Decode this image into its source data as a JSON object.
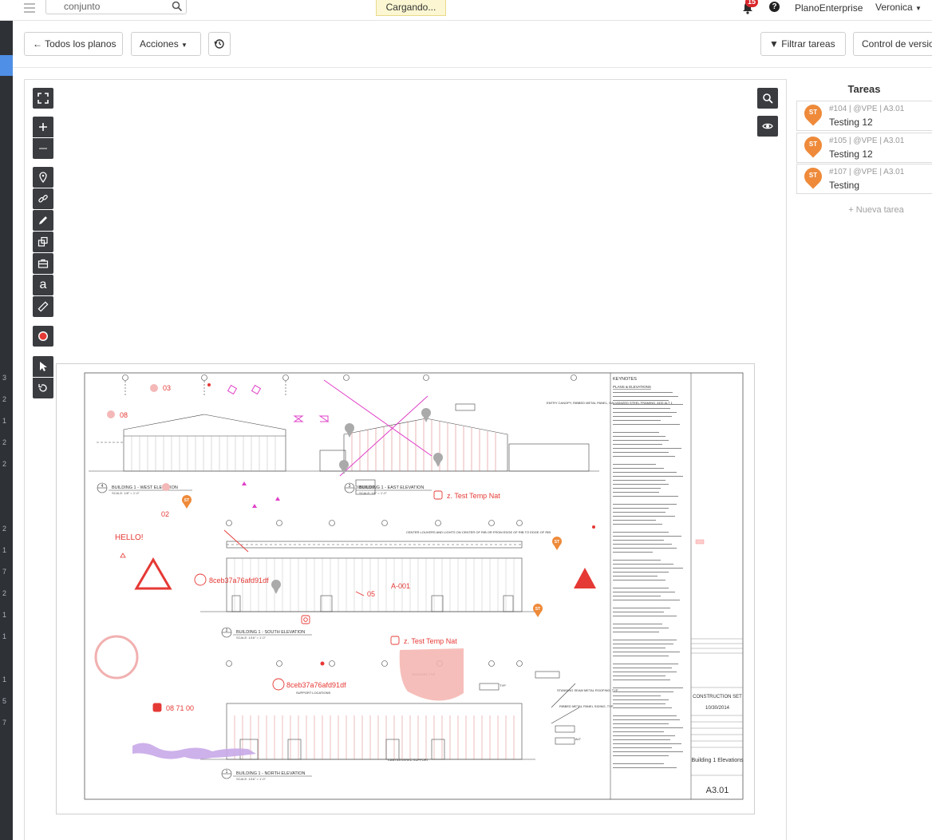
{
  "topbar": {
    "search_value": "conjunto",
    "loading_text": "Cargando...",
    "notifications_count": "15",
    "help": "?",
    "company": "PlanoEnterprise",
    "user": "Veronica"
  },
  "toolbar": {
    "all_plans": "Todos los planos",
    "actions": "Acciones",
    "filter_tasks": "Filtrar tareas",
    "version_control": "Control de versio"
  },
  "left_strip_numbers": [
    "3",
    "2",
    "1",
    "2",
    "2",
    "2",
    "1",
    "7",
    "2",
    "1",
    "1",
    "1",
    "5",
    "7"
  ],
  "sheet": {
    "annotations": {
      "n03": "03",
      "n08": "08",
      "n02": "02",
      "hello": "HELLO!",
      "link1": "8ceb37a76afd91df",
      "link2": "8ceb37a76afd91df",
      "a001": "A-001",
      "n05": "05",
      "temp1": "z. Test Temp Nat",
      "temp2": "z. Test Temp Nat",
      "num_087100": "08 71 00",
      "st": "ST"
    },
    "labels": {
      "west_num": "4",
      "west": "BUILDING 1 - WEST ELEVATION",
      "east_num": "3",
      "east": "BUILDING 1 - EAST ELEVATION",
      "south_num": "2",
      "south": "BUILDING 1 - SOUTH ELEVATION",
      "north_num": "1",
      "north": "BUILDING 1 - NORTH ELEVATION",
      "scale": "SCALE: 1/8\" = 1'-0\"",
      "scale_small": "SCALE: 1/16\" = 1'-0\"",
      "keynotes": "KEYNOTES",
      "plans_elev": "PLANS & ELEVATIONS",
      "construction": "CONSTRUCTION SET",
      "date": "10/30/2014",
      "sheet_title": "Building 1 Elevations",
      "sheet_no": "A3.01",
      "entry_canopy": "ENTRY CANOPY, RIBBED METAL PANEL, GALVANIZED STEEL FRAMING, ADD ALT 1",
      "center_louvers": "CENTER LOUVERS AND LIGHTS ON CENTER OF RIB OR FROM EDGE OF RIB TO EDGE OF RIB",
      "support_locations": "SUPPORT LOCATIONS",
      "skylight": "SKYLIGHT, TYP",
      "standing_seam": "STANDING SEAM METAL ROOFING, TYP",
      "ribbed_metal": "RIBBED METAL PANEL SIDING, TYP",
      "cantilevered": "CANTILEVERED SUPPORT",
      "typ": "TYP",
      "alt": "ALT"
    }
  },
  "tasks": {
    "title": "Tareas",
    "items": [
      {
        "meta": "#104 | @VPE | A3.01",
        "title": "Testing 12",
        "avatar": "ST"
      },
      {
        "meta": "#105 | @VPE | A3.01",
        "title": "Testing 12",
        "avatar": "ST"
      },
      {
        "meta": "#107 | @VPE | A3.01",
        "title": "Testing",
        "avatar": "ST"
      }
    ],
    "new_task": "+ Nueva tarea"
  },
  "colors": {
    "markup_red": "#e53935",
    "markup_pink": "#e040c8",
    "task_pin": "#ee8a3a",
    "tool_bg": "#3a3c40",
    "strip_bg": "#2e3136",
    "strip_active": "#4f8fe6"
  }
}
